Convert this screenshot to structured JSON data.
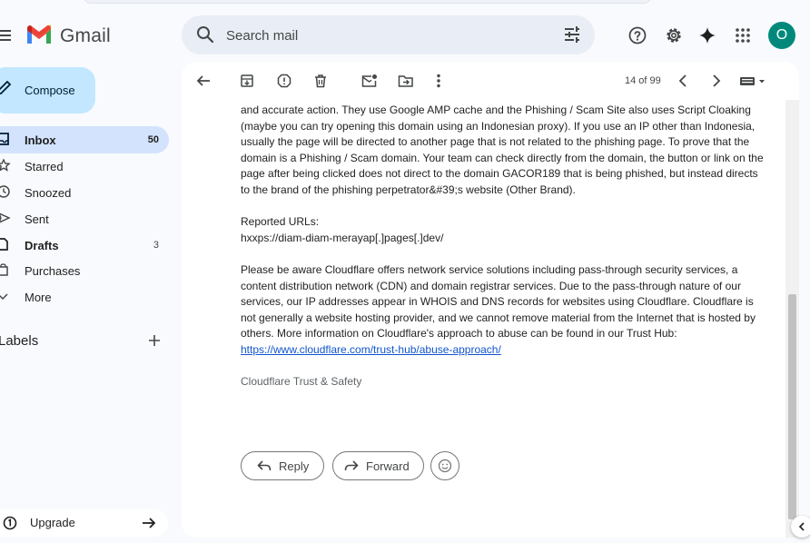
{
  "app": {
    "brand": "Gmail",
    "avatar_letter": "O"
  },
  "search": {
    "placeholder": "Search mail"
  },
  "compose": {
    "label": "Compose"
  },
  "sidebar": {
    "items": [
      {
        "label": "Inbox",
        "count": "50"
      },
      {
        "label": "Starred",
        "count": ""
      },
      {
        "label": "Snoozed",
        "count": ""
      },
      {
        "label": "Sent",
        "count": ""
      },
      {
        "label": "Drafts",
        "count": "3"
      },
      {
        "label": "Purchases",
        "count": ""
      },
      {
        "label": "More",
        "count": ""
      }
    ],
    "labels_title": "Labels",
    "upgrade": "Upgrade"
  },
  "toolbar": {
    "pager": "14 of 99"
  },
  "message": {
    "para1": "and accurate action. They use Google AMP cache and the Phishing / Scam Site also uses Script Cloaking (maybe you can try opening this domain using an Indonesian proxy). If you use an IP other than Indonesia, usually the page will be directed to another page that is not related to the phishing page. To prove that the domain is a Phishing / Scam domain. Your team can check directly from the domain, the button or link on the page after being clicked does not direct to the domain GACOR189 that is being phished, but instead directs to the brand of the phishing perpetrator&#39;s website (Other Brand).",
    "reported_heading": "Reported URLs:",
    "reported_url": "hxxps://diam-diam-merayap[.]pages[.]dev/",
    "para3": "Please be aware Cloudflare offers network service solutions including pass-through security services, a content distribution network (CDN) and domain registrar services. Due to the pass-through nature of our services, our IP addresses appear in WHOIS and DNS records for websites using Cloudflare. Cloudflare is not generally a website hosting provider, and we cannot remove material from the Internet that is hosted by others. More information on Cloudflare's approach to abuse can be found in our Trust Hub: ",
    "link": "https://www.cloudflare.com/trust-hub/abuse-approach/",
    "signature": "Cloudflare Trust & Safety"
  },
  "actions": {
    "reply": "Reply",
    "forward": "Forward"
  },
  "colors": {
    "accent": "#c2e7ff",
    "active_nav": "#d3e3fd",
    "avatar": "#00897b",
    "link": "#1155cc"
  }
}
